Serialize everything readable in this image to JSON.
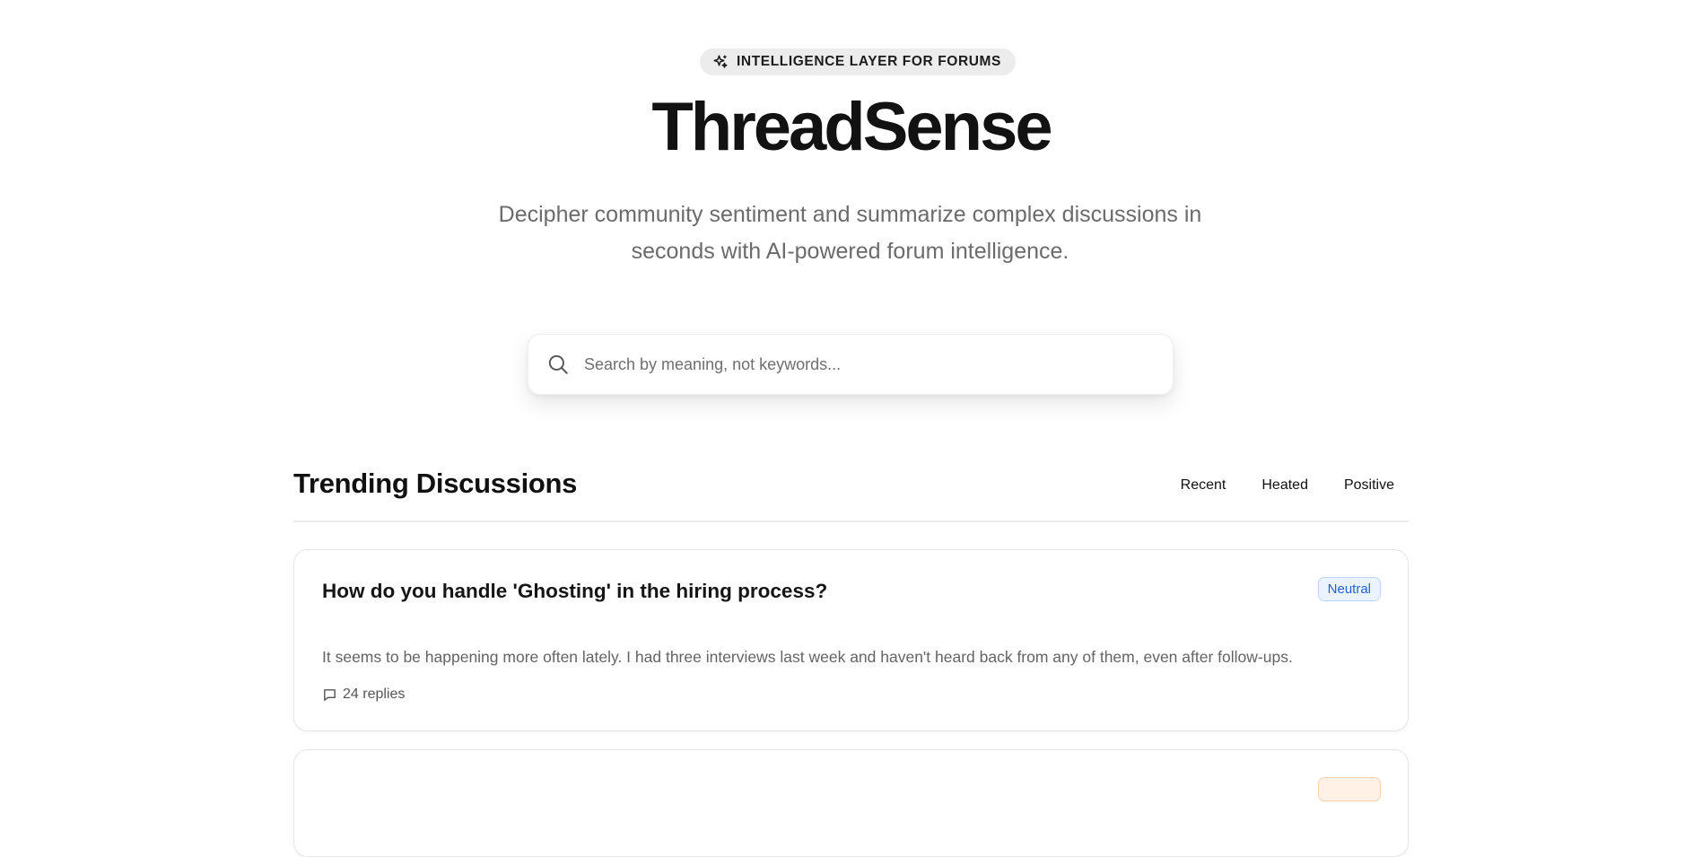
{
  "hero": {
    "badge_label": "INTELLIGENCE LAYER FOR FORUMS",
    "badge_icon": "sparkles-icon",
    "title": "ThreadSense",
    "subtitle": "Decipher community sentiment and summarize complex discussions in seconds with AI-powered forum intelligence."
  },
  "search": {
    "icon": "search-icon",
    "placeholder": "Search by meaning, not keywords..."
  },
  "trending": {
    "title": "Trending Discussions",
    "filters": [
      "Recent",
      "Heated",
      "Positive"
    ]
  },
  "threads": [
    {
      "title": "How do you handle 'Ghosting' in the hiring process?",
      "sentiment": "Neutral",
      "excerpt": "It seems to be happening more often lately. I had three interviews last week and haven't heard back from any of them, even after follow-ups.",
      "replies": "24 replies",
      "replies_icon": "comment-icon"
    }
  ],
  "colors": {
    "accent_neutral": "#1f63d6",
    "accent_neutral_bg": "#eaf3ff",
    "accent_heated": "#d9631c",
    "accent_heated_bg": "#fff1e6",
    "badge_bg": "#ececec",
    "title": "#121212",
    "muted_text": "#6b6b6b"
  }
}
